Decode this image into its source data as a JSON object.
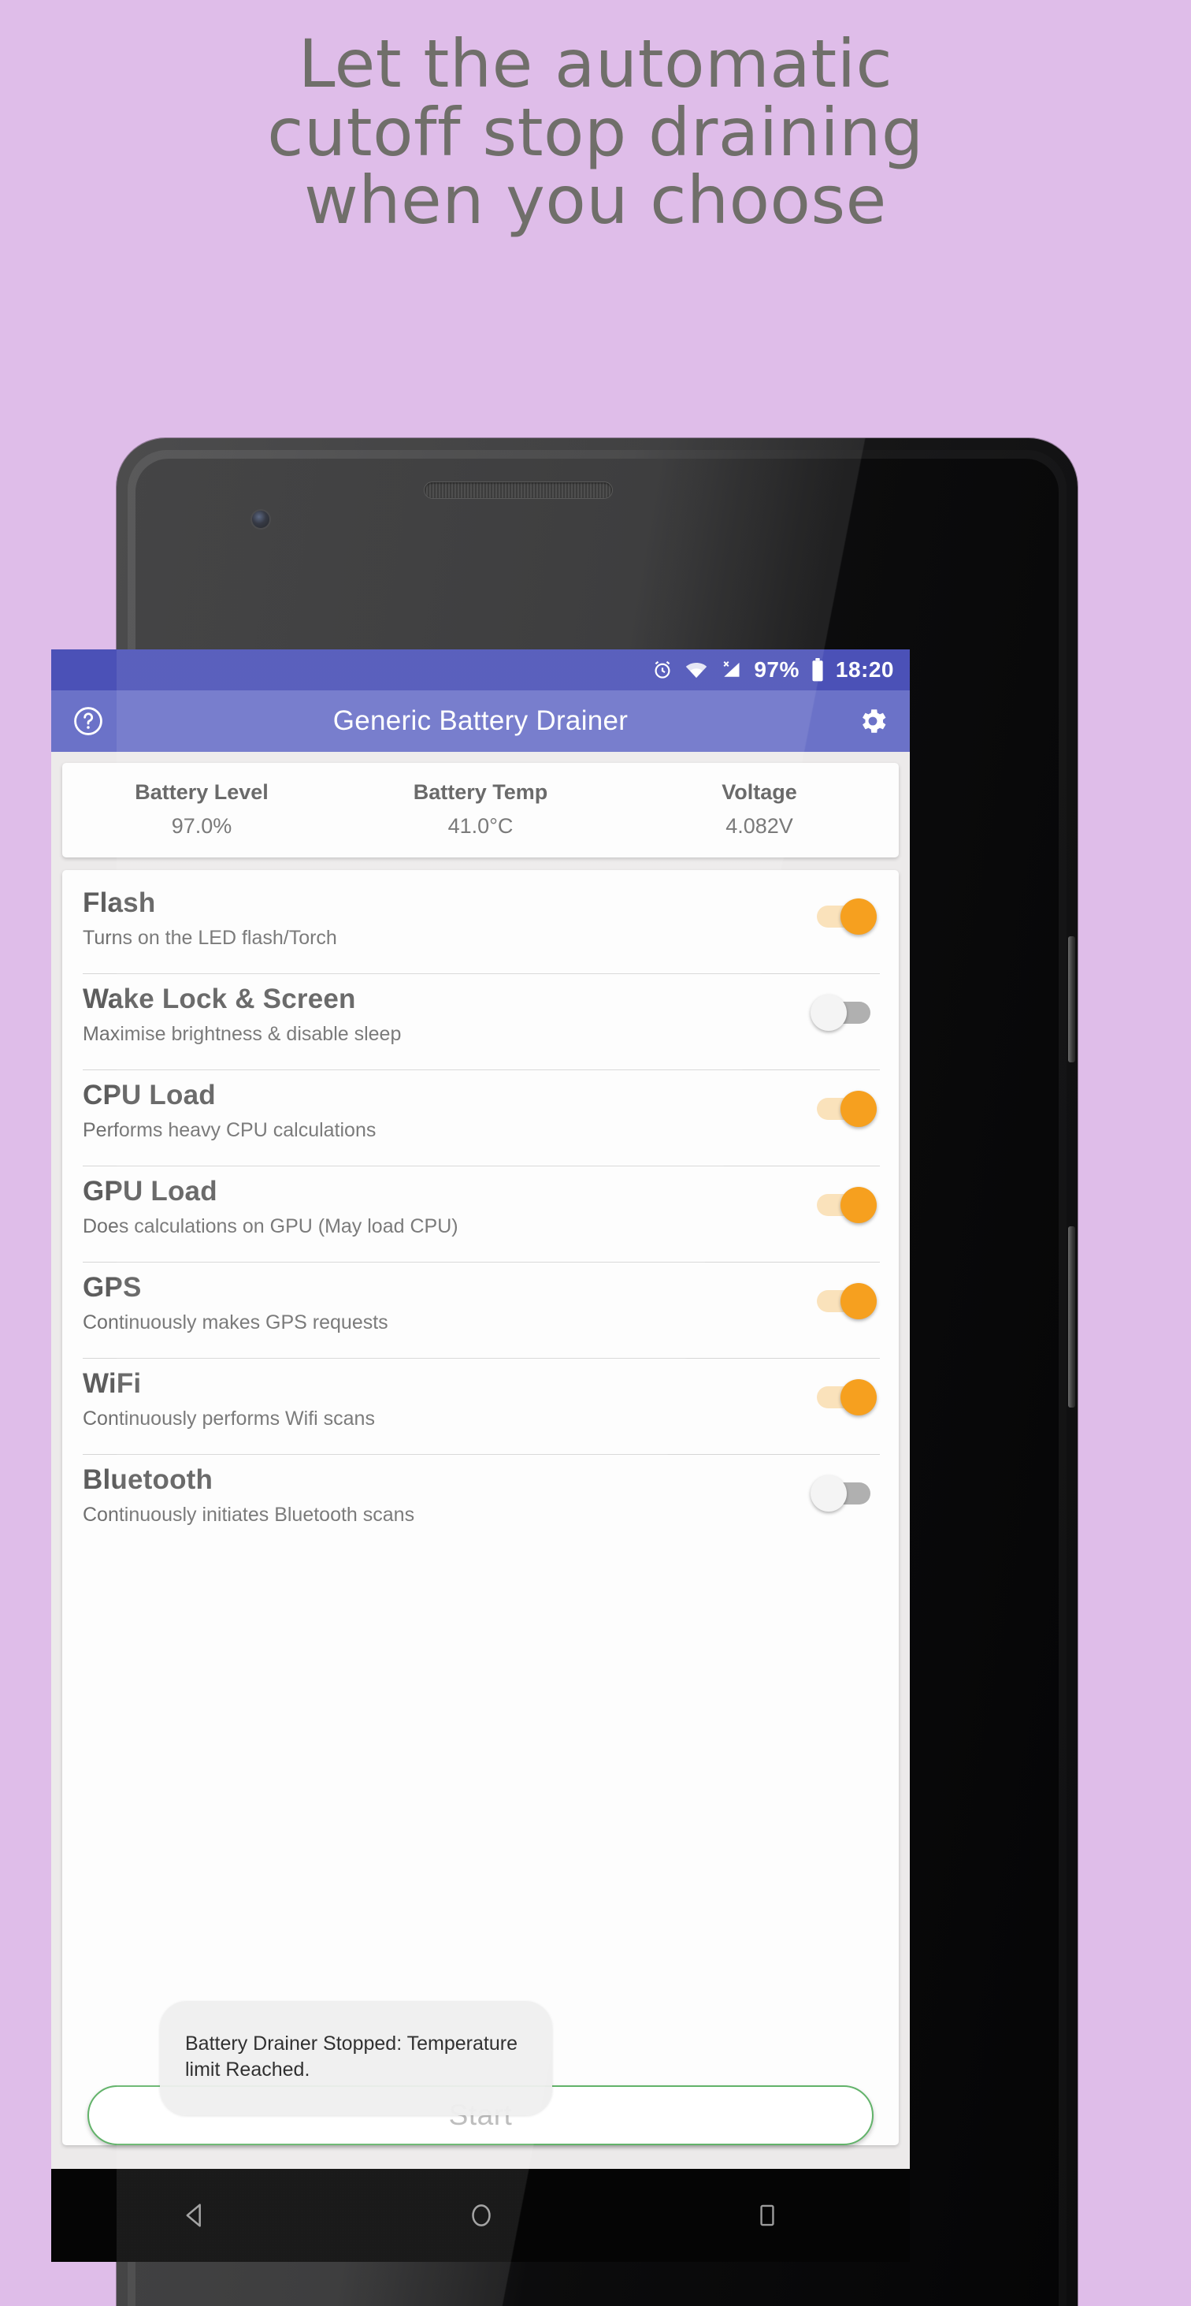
{
  "headline": {
    "line1": "Let the automatic",
    "line2": "cutoff stop draining",
    "line3": "when you choose"
  },
  "colors": {
    "background": "#dfbde9",
    "headline_text": "#706f6a",
    "status_bar": "#4b51b7",
    "app_bar": "#6b72c8",
    "toggle_on": "#f6a01f",
    "toggle_on_track": "#fae2bb",
    "toggle_off_thumb": "#f4f4f4",
    "toggle_off_track": "#b0b0b0",
    "start_button_border": "#62b36a"
  },
  "status_bar": {
    "alarm_icon": "alarm-icon",
    "wifi_icon": "wifi-icon",
    "signal_icon": "cellular-signal-no-sim-icon",
    "battery_percent": "97%",
    "battery_icon": "battery-full-icon",
    "clock": "18:20"
  },
  "app_bar": {
    "help_icon": "help-circle-icon",
    "title": "Generic Battery Drainer",
    "settings_icon": "gear-icon"
  },
  "stats": [
    {
      "label": "Battery Level",
      "value": "97.0%"
    },
    {
      "label": "Battery Temp",
      "value": "41.0°C"
    },
    {
      "label": "Voltage",
      "value": "4.082V"
    }
  ],
  "toggles": [
    {
      "title": "Flash",
      "subtitle": "Turns on the LED flash/Torch",
      "state": "on"
    },
    {
      "title": "Wake Lock & Screen",
      "subtitle": "Maximise brightness & disable sleep",
      "state": "off"
    },
    {
      "title": "CPU Load",
      "subtitle": "Performs heavy CPU calculations",
      "state": "on"
    },
    {
      "title": "GPU Load",
      "subtitle": "Does calculations on GPU (May load CPU)",
      "state": "on"
    },
    {
      "title": "GPS",
      "subtitle": "Continuously makes GPS requests",
      "state": "on"
    },
    {
      "title": "WiFi",
      "subtitle": "Continuously performs Wifi scans",
      "state": "on"
    },
    {
      "title": "Bluetooth",
      "subtitle": "Continuously initiates Bluetooth scans",
      "state": "off"
    }
  ],
  "bottom": {
    "start_label": "Start",
    "toast_message": "Battery Drainer Stopped: Temperature limit Reached."
  },
  "nav_bar": {
    "back_icon": "back-triangle-icon",
    "home_icon": "home-circle-icon",
    "recents_icon": "recents-square-icon"
  }
}
